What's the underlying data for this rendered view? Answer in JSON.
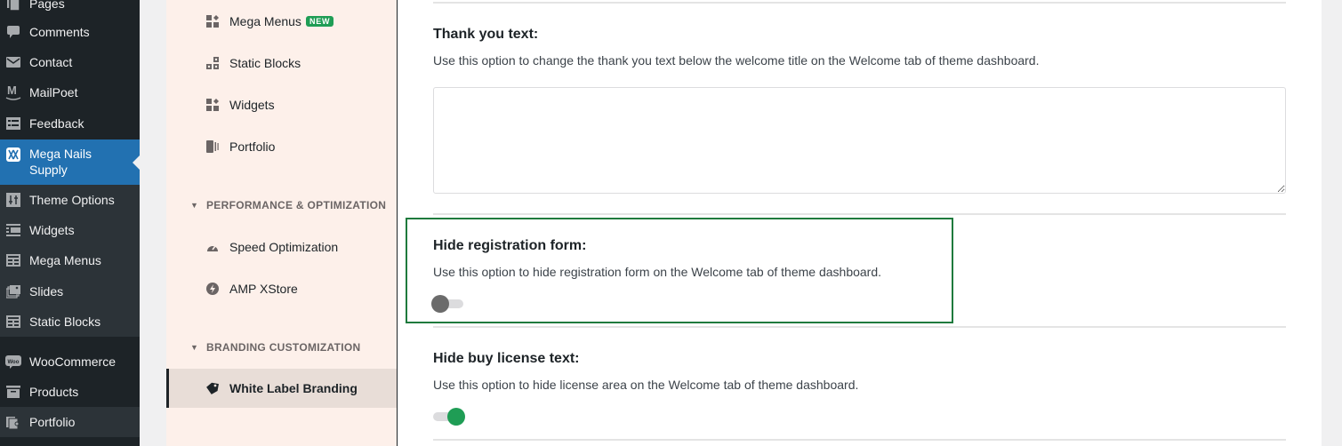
{
  "wp_sidebar": {
    "items": [
      {
        "label": "Pages",
        "icon": "pages-icon"
      },
      {
        "label": "Comments",
        "icon": "comments-icon"
      },
      {
        "label": "Contact",
        "icon": "envelope-icon"
      },
      {
        "label": "MailPoet",
        "icon": "mailpoet-icon"
      },
      {
        "label": "Feedback",
        "icon": "feedback-icon"
      },
      {
        "label": "Mega Nails Supply",
        "icon": "xstore-icon",
        "active": true
      },
      {
        "label": "Theme Options",
        "icon": "sliders-icon"
      },
      {
        "label": "Widgets",
        "icon": "widgets-icon"
      },
      {
        "label": "Mega Menus",
        "icon": "grid-icon"
      },
      {
        "label": "Slides",
        "icon": "slides-icon"
      },
      {
        "label": "Static Blocks",
        "icon": "grid-icon"
      },
      {
        "label": "WooCommerce",
        "icon": "woo-icon"
      },
      {
        "label": "Products",
        "icon": "archive-icon"
      },
      {
        "label": "Portfolio",
        "icon": "portfolio-icon"
      }
    ]
  },
  "panel": {
    "items_top": [
      {
        "label": "Mega Menus",
        "badge": "NEW"
      },
      {
        "label": "Static Blocks"
      },
      {
        "label": "Widgets"
      },
      {
        "label": "Portfolio"
      }
    ],
    "sections": [
      {
        "label": "PERFORMANCE & OPTIMIZATION",
        "items": [
          {
            "label": "Speed Optimization"
          },
          {
            "label": "AMP XStore"
          }
        ]
      },
      {
        "label": "BRANDING CUSTOMIZATION",
        "items": [
          {
            "label": "White Label Branding",
            "active": true
          }
        ]
      }
    ]
  },
  "content": {
    "options": [
      {
        "title": "Thank you text:",
        "description": "Use this option to change the thank you text below the welcome title on the Welcome tab of theme dashboard.",
        "type": "textarea",
        "value": ""
      },
      {
        "title": "Hide registration form:",
        "description": "Use this option to hide registration form on the Welcome tab of theme dashboard.",
        "type": "toggle",
        "checked": false,
        "highlighted": true
      },
      {
        "title": "Hide buy license text:",
        "description": "Use this option to hide license area on the Welcome tab of theme dashboard.",
        "type": "toggle",
        "checked": true
      }
    ]
  },
  "colors": {
    "wp_sidebar_bg": "#1d2327",
    "wp_active": "#2271b1",
    "panel_bg": "#fdf0ea",
    "accent_green": "#1f9d55",
    "highlight_border": "#1f7a3d"
  }
}
